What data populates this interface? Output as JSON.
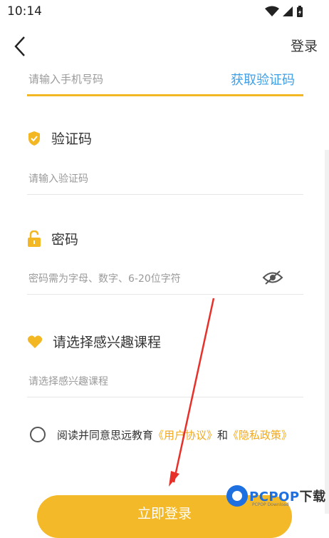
{
  "status_bar": {
    "time": "10:14"
  },
  "nav": {
    "login": "登录"
  },
  "phone": {
    "placeholder": "请输入手机号码",
    "get_code": "获取验证码"
  },
  "code_section": {
    "label": "验证码",
    "placeholder": "请输入验证码"
  },
  "password_section": {
    "label": "密码",
    "placeholder": "密码需为字母、数字、6-20位字符"
  },
  "course_section": {
    "label": "请选择感兴趣课程",
    "placeholder": "请选择感兴趣课程"
  },
  "agreement": {
    "prefix": "阅读并同意思远教育",
    "user_agreement": "《用户协议》",
    "and": "和",
    "privacy_policy": "《隐私政策》"
  },
  "submit": {
    "label": "立即登录"
  },
  "watermark": {
    "brand": "PCPOP",
    "suffix": "下载",
    "sub": "PCPOP Download"
  },
  "colors": {
    "accent": "#f3b928",
    "link_blue": "#3fa0e8",
    "link_orange": "#f2a91f"
  }
}
